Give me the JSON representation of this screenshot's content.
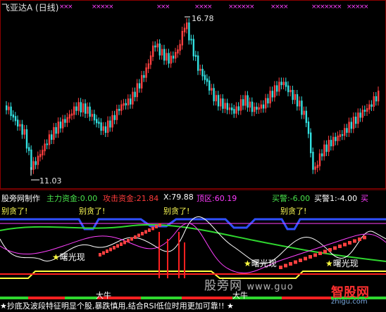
{
  "window": {
    "title": "飞亚达A (日线)"
  },
  "price_chart": {
    "high_label": "16.78",
    "low_label": "11.03",
    "top_markers": "×××  ××××  ××   ××××××  ××××  ××××××  ××××"
  },
  "indicator": {
    "name": "股旁网制作",
    "main_fund": "主力资金:0.00",
    "attack_fund": "攻击资金:21.84",
    "x_value": "X:79.88",
    "top_zone": "顶区:60.19",
    "buy_alert": "买警:-6.00",
    "buy_alert1": "买警1:-4.00",
    "buy_cut": "买"
  },
  "alerts": {
    "sell_warning": "别贪了!"
  },
  "signals": {
    "dawn": "曙光现",
    "bull": "大牛"
  },
  "watermark": {
    "site_cn": "股旁网",
    "site_url": "www.guo",
    "brand": "智股网",
    "brand_url": "zhigu.com"
  },
  "ticker": "★抄底及波段特征明显个股,暴跌慎用,结合RSI低位时用更加可靠!! ★",
  "colors": {
    "up": "#ff4040",
    "down": "#33e0e0",
    "green": "#2fd82f",
    "yellow": "#ffff40",
    "magenta": "#ff40ff",
    "blue": "#3050ff",
    "red": "#ff2020"
  }
}
